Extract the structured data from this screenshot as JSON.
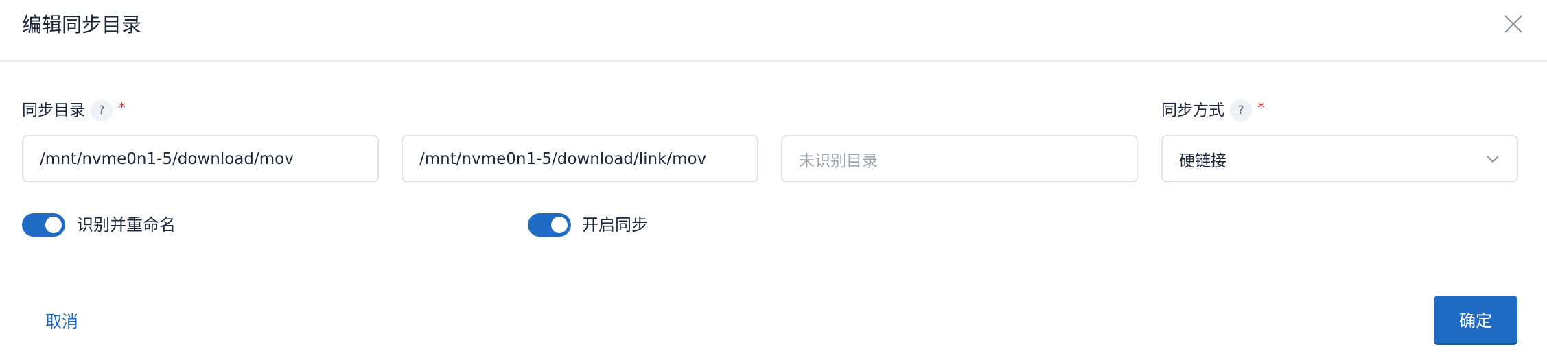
{
  "dialog": {
    "title": "编辑同步目录",
    "close_icon": "close-icon"
  },
  "form": {
    "sync_dir": {
      "label": "同步目录",
      "help": "?",
      "required": "*",
      "source": "/mnt/nvme0n1-5/download/mov",
      "target": "/mnt/nvme0n1-5/download/link/mov",
      "unrecognized_placeholder": "未识别目录"
    },
    "sync_mode": {
      "label": "同步方式",
      "help": "?",
      "required": "*",
      "value": "硬链接"
    },
    "rename_toggle": {
      "label": "识别并重命名",
      "on": true
    },
    "enable_toggle": {
      "label": "开启同步",
      "on": true
    }
  },
  "footer": {
    "cancel": "取消",
    "confirm": "确定"
  },
  "colors": {
    "accent": "#206bc4",
    "required": "#d63939"
  }
}
